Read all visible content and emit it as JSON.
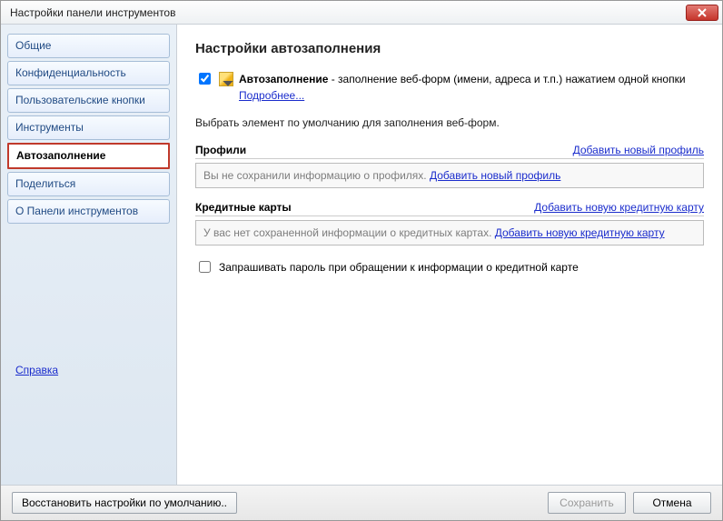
{
  "window": {
    "title": "Настройки панели инструментов"
  },
  "sidebar": {
    "items": [
      {
        "label": "Общие"
      },
      {
        "label": "Конфиденциальность"
      },
      {
        "label": "Пользовательские кнопки"
      },
      {
        "label": "Инструменты"
      },
      {
        "label": "Автозаполнение"
      },
      {
        "label": "Поделиться"
      },
      {
        "label": "О Панели инструментов"
      }
    ],
    "help": "Справка"
  },
  "main": {
    "heading": "Настройки автозаполнения",
    "feature": {
      "checked": true,
      "name": "Автозаполнение",
      "desc": " - заполнение веб-форм (имени, адреса и т.п.) нажатием одной кнопки   ",
      "more": "Подробнее..."
    },
    "select_default": "Выбрать элемент по умолчанию для заполнения веб-форм.",
    "profiles": {
      "title": "Профили",
      "add": "Добавить новый профиль",
      "empty": "Вы не сохранили информацию о профилях. ",
      "empty_link": "Добавить новый профиль"
    },
    "cards": {
      "title": "Кредитные карты",
      "add": "Добавить новую кредитную карту",
      "empty": "У вас нет сохраненной информации о кредитных картах. ",
      "empty_link": "Добавить новую кредитную карту",
      "pw_checked": false,
      "pw_label": "Запрашивать пароль при обращении к информации о кредитной карте"
    }
  },
  "footer": {
    "restore": "Восстановить настройки по умолчанию..",
    "save": "Сохранить",
    "cancel": "Отмена"
  }
}
